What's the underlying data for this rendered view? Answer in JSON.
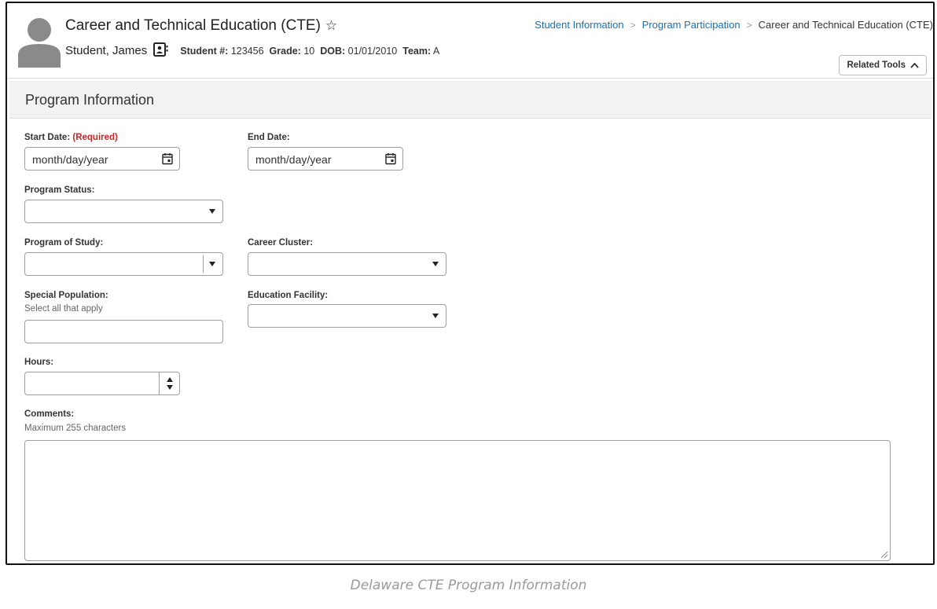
{
  "header": {
    "title": "Career and Technical Education (CTE)",
    "student_name": "Student, James",
    "student_num_label": "Student #:",
    "student_num": "123456",
    "grade_label": "Grade:",
    "grade": "10",
    "dob_label": "DOB:",
    "dob": "01/01/2010",
    "team_label": "Team:",
    "team": "A",
    "icons": [
      "avatar",
      "favorite-star-icon",
      "id-card-icon"
    ]
  },
  "breadcrumb": {
    "items": [
      "Student Information",
      "Program Participation",
      "Career and Technical Education (CTE)"
    ],
    "separator": ">"
  },
  "related_tools": {
    "label": "Related Tools",
    "icon": "chevron-up-icon"
  },
  "section": {
    "title": "Program Information"
  },
  "form": {
    "start_date": {
      "label": "Start Date:",
      "required": "(Required)",
      "placeholder": "month/day/year"
    },
    "end_date": {
      "label": "End Date:",
      "placeholder": "month/day/year"
    },
    "program_status": {
      "label": "Program Status:",
      "value": ""
    },
    "program_of_study": {
      "label": "Program of Study:",
      "value": ""
    },
    "career_cluster": {
      "label": "Career Cluster:",
      "value": ""
    },
    "special_population": {
      "label": "Special Population:",
      "hint": "Select all that apply",
      "value": ""
    },
    "education_facility": {
      "label": "Education Facility:",
      "value": ""
    },
    "hours": {
      "label": "Hours:",
      "value": ""
    },
    "comments": {
      "label": "Comments:",
      "hint": "Maximum 255 characters",
      "value": ""
    }
  },
  "caption": "Delaware CTE Program Information",
  "colors": {
    "link": "#1a6fb5",
    "required": "#c62828",
    "section_bg": "#f2f2f2",
    "caption": "#9a9a9a"
  }
}
